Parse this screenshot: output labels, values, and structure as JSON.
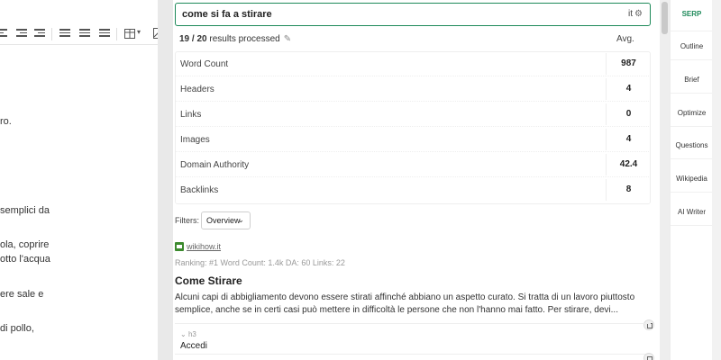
{
  "editor": {
    "lines": [
      "ro.",
      "semplici da",
      "ola, coprire",
      "otto l'acqua",
      "ere sale e",
      "di pollo,"
    ]
  },
  "search": {
    "query": "come si fa a stirare",
    "lang": "it",
    "lang_icon": "gear-icon"
  },
  "summary": {
    "processed_count": "19 / 20",
    "processed_label": "results processed",
    "avg_label": "Avg."
  },
  "metrics": [
    {
      "label": "Word Count",
      "value": "987"
    },
    {
      "label": "Headers",
      "value": "4"
    },
    {
      "label": "Links",
      "value": "0"
    },
    {
      "label": "Images",
      "value": "4"
    },
    {
      "label": "Domain Authority",
      "value": "42.4"
    },
    {
      "label": "Backlinks",
      "value": "8"
    }
  ],
  "filters": {
    "label": "Filters:",
    "selected": "Overview"
  },
  "result": {
    "site": "wikihow.it",
    "meta": "Ranking: #1   Word Count: 1.4k   DA: 60   Links: 22",
    "title": "Come Stirare",
    "snippet": "Alcuni capi di abbigliamento devono essere stirati affinché abbiano un aspetto curato. Si tratta di un lavoro piuttosto semplice, anche se in certi casi può mettere in difficoltà le persone che non l'hanno mai fatto. Per stirare, devi...",
    "heading_tag": "h3",
    "heading_text": "Accedi"
  },
  "nav": {
    "items": [
      "SERP",
      "Outline",
      "Brief",
      "Optimize",
      "Questions",
      "Wikipedia",
      "AI Writer"
    ],
    "active": "SERP"
  },
  "colors": {
    "accent": "#1e8a5a"
  }
}
